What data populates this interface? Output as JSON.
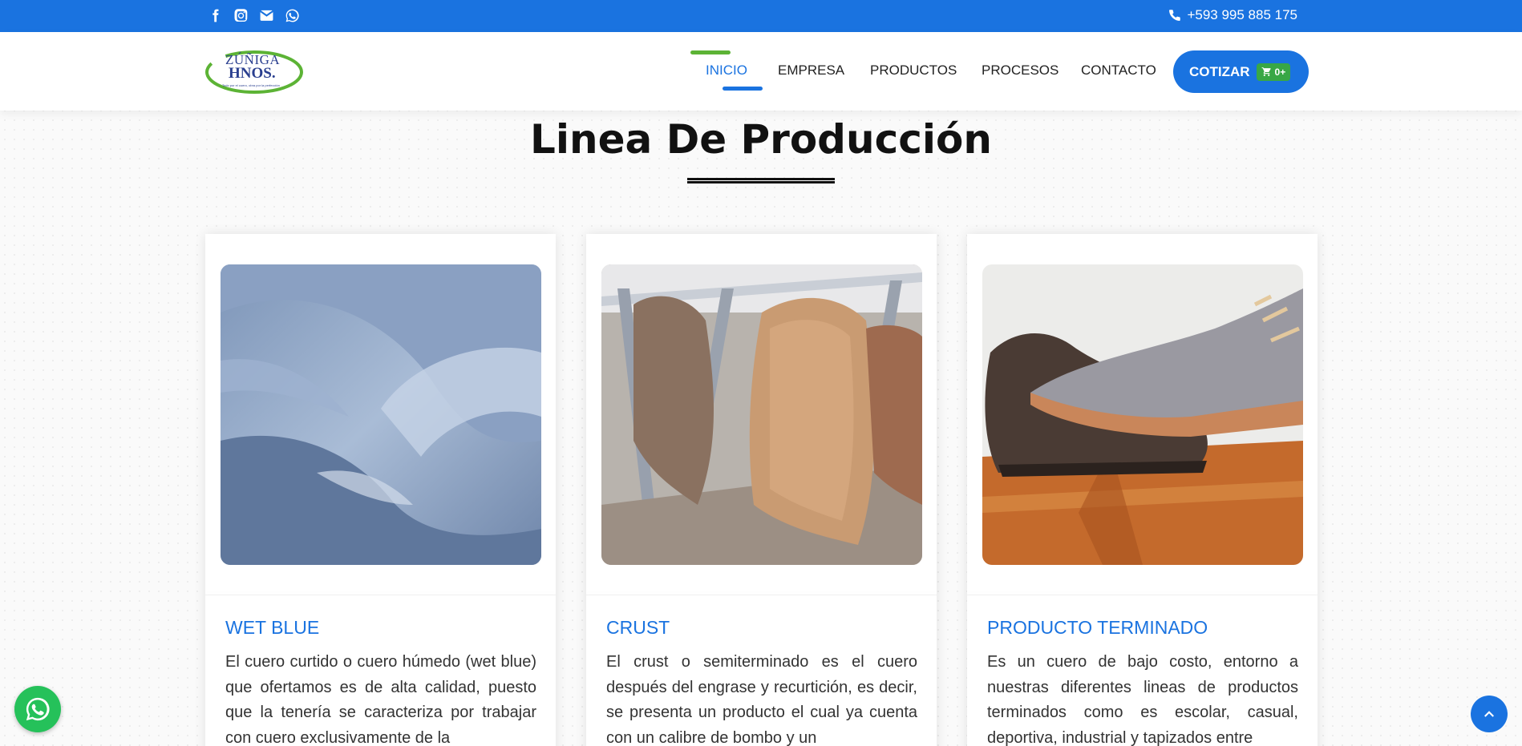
{
  "topbar": {
    "social_icons": [
      "facebook-icon",
      "instagram-icon",
      "envelope-icon",
      "whatsapp-icon"
    ],
    "phone": "+593 995 885 175"
  },
  "logo": {
    "line1": "ZÚÑIGA",
    "line2": "HNOS.",
    "tagline": "Todo por el cuero, obra por la perfección"
  },
  "nav": {
    "items": [
      {
        "label": "INICIO",
        "active": true
      },
      {
        "label": "EMPRESA",
        "active": false
      },
      {
        "label": "PRODUCTOS",
        "active": false
      },
      {
        "label": "PROCESOS",
        "active": false
      },
      {
        "label": "CONTACTO",
        "active": false
      }
    ],
    "cotizar_label": "COTIZAR",
    "cart_count": "0+"
  },
  "section": {
    "title": "Linea De Producción"
  },
  "cards": [
    {
      "title": "WET BLUE",
      "description": "El cuero curtido o cuero húmedo (wet blue) que ofertamos es de alta calidad, puesto que la tenería se caracteriza por trabajar con cuero exclusivamente de la"
    },
    {
      "title": "CRUST",
      "description": "El crust o semiterminado es el cuero después del engrase y recurtición, es decir, se presenta un producto el cual ya cuenta con un calibre de bombo y un"
    },
    {
      "title": "PRODUCTO TERMINADO",
      "description": "Es un cuero de bajo costo, entorno a nuestras diferentes lineas de productos terminados como es escolar, casual, deportiva, industrial y tapizados entre"
    }
  ],
  "colors": {
    "primary": "#1a73e0",
    "accent_green": "#5cb335",
    "whatsapp": "#25c15a"
  }
}
